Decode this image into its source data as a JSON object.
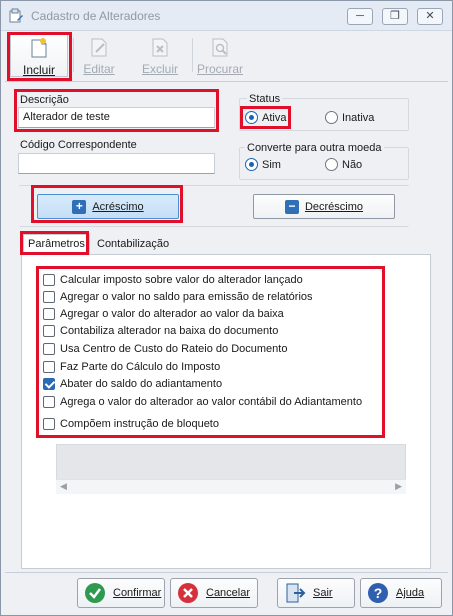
{
  "window": {
    "title": "Cadastro de Alteradores"
  },
  "titlebar_buttons": {
    "minimize": "─",
    "restore": "❐",
    "close": "✕"
  },
  "toolbar": {
    "incluir": "Incluir",
    "editar": "Editar",
    "excluir": "Excluir",
    "procurar": "Procurar"
  },
  "form": {
    "descricao_label": "Descrição",
    "descricao_value": "Alterador de teste",
    "codigo_label": "Código Correspondente",
    "codigo_value": "",
    "status_label": "Status",
    "status_options": [
      "Ativa",
      "Inativa"
    ],
    "status_selected": "Ativa",
    "moeda_label": "Converte para outra moeda",
    "moeda_options": [
      "Sim",
      "Não"
    ],
    "moeda_selected": "Sim"
  },
  "type_buttons": {
    "acrescimo": "Acréscimo",
    "decrescimo": "Decréscimo",
    "selected": "Acréscimo"
  },
  "tabs": {
    "parametros": "Parâmetros",
    "contabilizacao": "Contabilização",
    "active": "Parâmetros"
  },
  "parametros": [
    {
      "label": "Calcular imposto sobre valor do alterador lançado",
      "checked": false
    },
    {
      "label": "Agregar o valor no saldo para emissão de relatórios",
      "checked": false
    },
    {
      "label": "Agregar o valor do alterador ao valor da baixa",
      "checked": false
    },
    {
      "label": "Contabiliza alterador na baixa do documento",
      "checked": false
    },
    {
      "label": "Usa Centro de Custo do Rateio do Documento",
      "checked": false
    },
    {
      "label": "Faz Parte do Cálculo do Imposto",
      "checked": false
    },
    {
      "label": "Abater do saldo do adiantamento",
      "checked": true
    },
    {
      "label": "Agrega o valor do alterador ao valor contábil do Adiantamento",
      "checked": false
    },
    {
      "label": "Compõem instrução de bloqueto",
      "checked": false
    }
  ],
  "bottom_buttons": {
    "confirmar": "Confirmar",
    "cancelar": "Cancelar",
    "sair": "Sair",
    "ajuda": "Ajuda"
  },
  "colors": {
    "highlight": "#e0102a",
    "accent": "#1b63b5",
    "selected_button": "#c5def5"
  }
}
